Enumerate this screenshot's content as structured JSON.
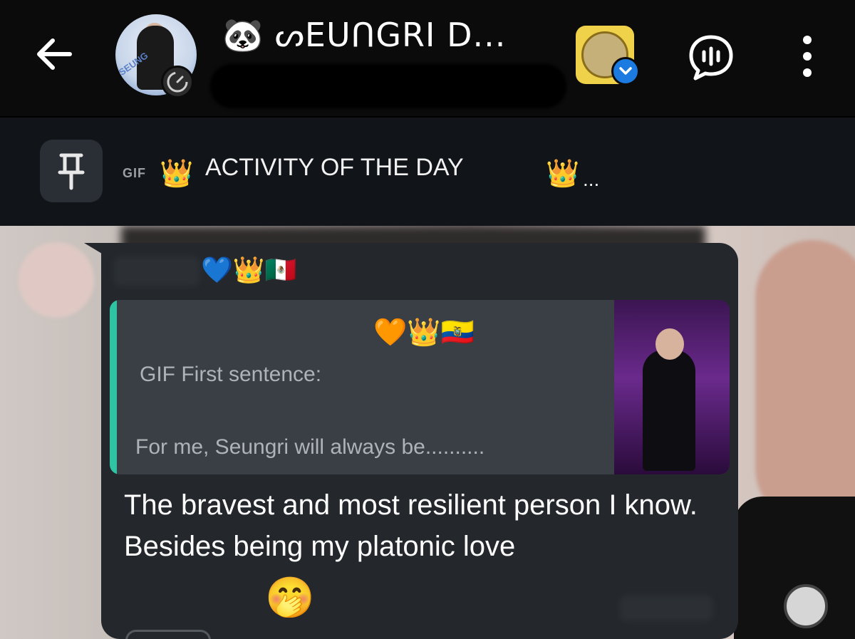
{
  "header": {
    "back_icon": "arrow-left-icon",
    "avatar_ring_text": "SEUNG",
    "title_emoji": "🐼",
    "title": "ᔕEUᑎGRI D...",
    "community_badge_icon": "community-logo-icon",
    "dropdown_icon": "chevron-down-icon",
    "voice_chat_icon": "voice-chat-icon",
    "menu_icon": "more-vertical-icon",
    "accent": "#1c7be0"
  },
  "pinned": {
    "pin_icon": "pin-icon",
    "gif_label": "GIF",
    "crown_left": "👑",
    "text": "ACTIVITY OF THE DAY",
    "crown_right": "👑",
    "ellipsis": "..."
  },
  "message": {
    "sender_emojis": "💙👑🇲🇽",
    "quote": {
      "emojis": "🧡👑🇪🇨",
      "line1": "GIF First sentence:",
      "line2": "For me, Seungri will always be..........",
      "bar_color": "#2ec4a3"
    },
    "text": "The bravest and most resilient person I know. Besides being my platonic love",
    "emoji": "🤭"
  }
}
